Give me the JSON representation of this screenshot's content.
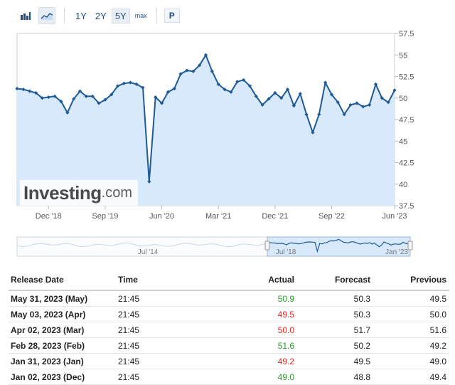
{
  "toolbar": {
    "icons": [
      "bar-chart-icon",
      "area-chart-icon"
    ],
    "ranges": [
      "1Y",
      "2Y",
      "5Y",
      "max"
    ],
    "active_range": "5Y",
    "p_button": "P"
  },
  "watermark": {
    "brand": "Investing",
    "suffix": ".com"
  },
  "chart_data": {
    "type": "area",
    "ylim": [
      37.5,
      57.5
    ],
    "yticks": [
      "57.5",
      "55",
      "52.5",
      "50",
      "47.5",
      "45",
      "42.5",
      "40",
      "37.5"
    ],
    "xticks": [
      "Dec '18",
      "Sep '19",
      "Jun '20",
      "Mar '21",
      "Dec '21",
      "Sep '22",
      "Jun '23"
    ],
    "series": [
      {
        "values": [
          51.1,
          51.0,
          50.8,
          50.6,
          50.0,
          50.1,
          50.2,
          49.6,
          48.3,
          49.9,
          50.8,
          50.2,
          50.2,
          49.4,
          49.8,
          50.4,
          51.4,
          51.7,
          51.8,
          51.6,
          51.2,
          40.3,
          50.1,
          49.4,
          50.7,
          51.1,
          52.8,
          53.2,
          53.1,
          53.8,
          55.0,
          53.1,
          51.6,
          51.0,
          50.7,
          51.9,
          52.1,
          51.4,
          50.2,
          49.2,
          49.9,
          50.6,
          50.0,
          51.0,
          49.1,
          50.5,
          48.1,
          46.0,
          48.1,
          51.8,
          50.4,
          49.5,
          48.1,
          49.2,
          49.4,
          49.0,
          49.2,
          51.6,
          50.0,
          49.5,
          50.9
        ]
      }
    ]
  },
  "navigator": {
    "labels": [
      "Jul '14",
      "Jul '18",
      "Jan '23"
    ]
  },
  "table": {
    "headers": [
      "Release Date",
      "Time",
      "Actual",
      "Forecast",
      "Previous"
    ],
    "rows": [
      {
        "date": "May 31, 2023 (May)",
        "time": "21:45",
        "actual": "50.9",
        "actual_color": "green",
        "forecast": "50.3",
        "previous": "49.5"
      },
      {
        "date": "May 03, 2023 (Apr)",
        "time": "21:45",
        "actual": "49.5",
        "actual_color": "red",
        "forecast": "50.3",
        "previous": "50.0"
      },
      {
        "date": "Apr 02, 2023 (Mar)",
        "time": "21:45",
        "actual": "50.0",
        "actual_color": "red",
        "forecast": "51.7",
        "previous": "51.6"
      },
      {
        "date": "Feb 28, 2023 (Feb)",
        "time": "21:45",
        "actual": "51.6",
        "actual_color": "green",
        "forecast": "50.2",
        "previous": "49.2"
      },
      {
        "date": "Jan 31, 2023 (Jan)",
        "time": "21:45",
        "actual": "49.2",
        "actual_color": "red",
        "forecast": "49.5",
        "previous": "49.0"
      },
      {
        "date": "Jan 02, 2023 (Dec)",
        "time": "21:45",
        "actual": "49.0",
        "actual_color": "green",
        "forecast": "48.8",
        "previous": "49.4"
      }
    ]
  },
  "colors": {
    "line": "#1e5a96",
    "area": "#d7e9fb",
    "green": "#2a9a2a",
    "red": "#e0251f"
  }
}
